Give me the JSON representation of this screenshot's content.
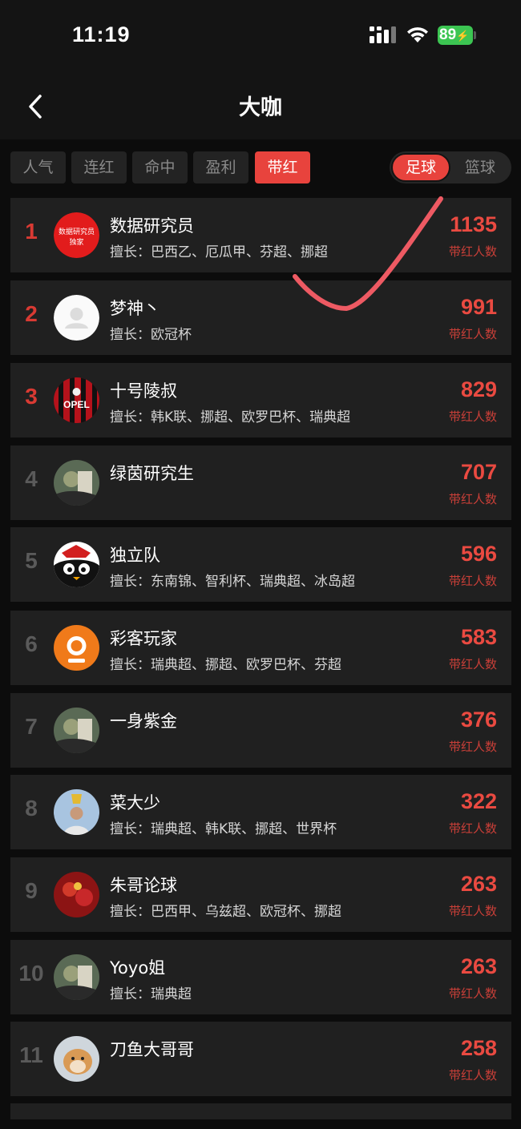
{
  "status_bar": {
    "time": "11:19",
    "battery": "89"
  },
  "header": {
    "title": "大咖"
  },
  "tabs": [
    {
      "label": "人气",
      "active": false
    },
    {
      "label": "连红",
      "active": false
    },
    {
      "label": "命中",
      "active": false
    },
    {
      "label": "盈利",
      "active": false
    },
    {
      "label": "带红",
      "active": true
    }
  ],
  "sport_toggle": {
    "football": "足球",
    "basketball": "篮球",
    "selected": "足球"
  },
  "count_label": "带红人数",
  "experts": [
    {
      "rank": "1",
      "name": "数据研究员",
      "specialty": "擅长：巴西乙、厄瓜甲、芬超、挪超",
      "count": "1135",
      "avatar": "data-researcher-avatar"
    },
    {
      "rank": "2",
      "name": "梦神丶",
      "specialty": "擅长：欧冠杯",
      "count": "991",
      "avatar": "default-avatar"
    },
    {
      "rank": "3",
      "name": "十号陵叔",
      "specialty": "擅长：韩K联、挪超、欧罗巴杯、瑞典超",
      "count": "829",
      "avatar": "jersey-avatar"
    },
    {
      "rank": "4",
      "name": "绿茵研究生",
      "specialty": "",
      "count": "707",
      "avatar": "photo-avatar"
    },
    {
      "rank": "5",
      "name": "独立队",
      "specialty": "擅长：东南锦、智利杯、瑞典超、冰岛超",
      "count": "596",
      "avatar": "cartoon-avatar"
    },
    {
      "rank": "6",
      "name": "彩客玩家",
      "specialty": "擅长：瑞典超、挪超、欧罗巴杯、芬超",
      "count": "583",
      "avatar": "orange-logo-avatar"
    },
    {
      "rank": "7",
      "name": "一身紫金",
      "specialty": "",
      "count": "376",
      "avatar": "photo-avatar"
    },
    {
      "rank": "8",
      "name": "菜大少",
      "specialty": "擅长：瑞典超、韩K联、挪超、世界杯",
      "count": "322",
      "avatar": "trophy-avatar"
    },
    {
      "rank": "9",
      "name": "朱哥论球",
      "specialty": "擅长：巴西甲、乌兹超、欧冠杯、挪超",
      "count": "263",
      "avatar": "red-photo-avatar"
    },
    {
      "rank": "10",
      "name": "Yoyo姐",
      "specialty": "擅长：瑞典超",
      "count": "263",
      "avatar": "photo-avatar"
    },
    {
      "rank": "11",
      "name": "刀鱼大哥哥",
      "specialty": "",
      "count": "258",
      "avatar": "dog-avatar"
    }
  ],
  "avatar_logo_text": {
    "top": "数据研究员",
    "bottom": "独家"
  },
  "jersey_text": "OPEL",
  "colors": {
    "accent": "#e8433d",
    "rank_top": "#d93a33",
    "rank_other": "#5a5a5a",
    "background": "#141414",
    "row": "#202020"
  }
}
